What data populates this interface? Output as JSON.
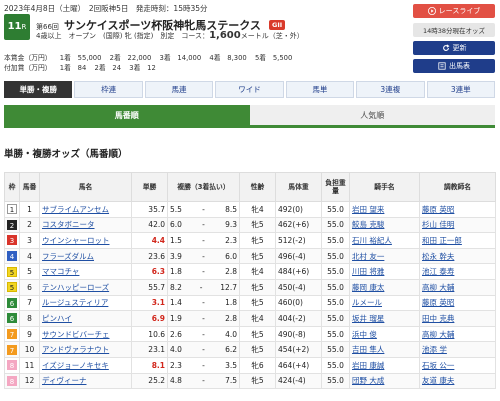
{
  "header": {
    "date_line": "2023年4月8日（土曜）　2回阪神5日　発走時刻：15時35分",
    "race_number": "11",
    "race_unit": "R",
    "race_count_label": "第66回",
    "race_name": "サンケイスポーツ杯阪神牝馬ステークス",
    "grade": "GII",
    "conditions_prefix": "4歳以上　オープン　(国際) 牝 (指定)　別定　コース：",
    "distance": "1,600",
    "conditions_suffix": "メートル（芝・外）",
    "prize_main": [
      "本賞金（万円）",
      "1着　55,000",
      "2着　22,000",
      "3着　14,000",
      "4着　8,300",
      "5着　5,500"
    ],
    "prize_extra": [
      "付加賞（万円）",
      "1着　84",
      "2着　24",
      "3着　12"
    ]
  },
  "side_buttons": {
    "live": "レースライブ",
    "time": "14時38分現在オッズ",
    "refresh": "更新",
    "entries": "出馬表"
  },
  "bet_tabs": [
    "単勝・複勝",
    "枠連",
    "馬連",
    "ワイド",
    "馬単",
    "3連複",
    "3連単"
  ],
  "view_tabs": [
    "馬番順",
    "人気順"
  ],
  "section_title": "単勝・複勝オッズ（馬番順）",
  "table": {
    "headers": {
      "waku": "枠",
      "umaban": "馬番",
      "name": "馬名",
      "win": "単勝",
      "place": "複勝（3着払い）",
      "sex_age": "性齢",
      "weight": "馬体重",
      "burden": "負担重量",
      "jockey": "騎手名",
      "trainer": "調教師名"
    },
    "rows": [
      {
        "waku": "1",
        "umaban": "1",
        "name": "サブライムアンセム",
        "win": "35.7",
        "place_min": "5.5",
        "place_dash": "-",
        "place_max": "8.5",
        "sex_age": "牝4",
        "weight": "492(0)",
        "burden": "55.0",
        "jockey": "岩田 望来",
        "trainer": "藤原 英昭",
        "hot": false
      },
      {
        "waku": "2",
        "umaban": "2",
        "name": "コスタボニータ",
        "win": "42.0",
        "place_min": "6.0",
        "place_dash": "-",
        "place_max": "9.3",
        "sex_age": "牝5",
        "weight": "462(+6)",
        "burden": "55.0",
        "jockey": "鮫島 克駿",
        "trainer": "杉山 佳明",
        "hot": false
      },
      {
        "waku": "3",
        "umaban": "3",
        "name": "ウインシャーロット",
        "win": "4.4",
        "place_min": "1.5",
        "place_dash": "-",
        "place_max": "2.3",
        "sex_age": "牝5",
        "weight": "512(-2)",
        "burden": "55.0",
        "jockey": "石川 裕紀人",
        "trainer": "和田 正一郎",
        "hot": true
      },
      {
        "waku": "4",
        "umaban": "4",
        "name": "フラーズダルム",
        "win": "23.6",
        "place_min": "3.9",
        "place_dash": "-",
        "place_max": "6.0",
        "sex_age": "牝5",
        "weight": "496(-4)",
        "burden": "55.0",
        "jockey": "北村 友一",
        "trainer": "松永 幹夫",
        "hot": false
      },
      {
        "waku": "5",
        "umaban": "5",
        "name": "ママコチャ",
        "win": "6.3",
        "place_min": "1.8",
        "place_dash": "-",
        "place_max": "2.8",
        "sex_age": "牝4",
        "weight": "484(+6)",
        "burden": "55.0",
        "jockey": "川田 将雅",
        "trainer": "池江 泰寿",
        "hot": true
      },
      {
        "waku": "5",
        "umaban": "6",
        "name": "テンハッピーローズ",
        "win": "55.7",
        "place_min": "8.2",
        "place_dash": "-",
        "place_max": "12.7",
        "sex_age": "牝5",
        "weight": "450(-4)",
        "burden": "55.0",
        "jockey": "藤岡 康太",
        "trainer": "高柳 大輔",
        "hot": false
      },
      {
        "waku": "6",
        "umaban": "7",
        "name": "ルージュスティリア",
        "win": "3.1",
        "place_min": "1.4",
        "place_dash": "-",
        "place_max": "1.8",
        "sex_age": "牝5",
        "weight": "460(0)",
        "burden": "55.0",
        "jockey": "ルメール",
        "trainer": "藤原 英昭",
        "hot": true
      },
      {
        "waku": "6",
        "umaban": "8",
        "name": "ピンハイ",
        "win": "6.9",
        "place_min": "1.9",
        "place_dash": "-",
        "place_max": "2.8",
        "sex_age": "牝4",
        "weight": "404(-2)",
        "burden": "55.0",
        "jockey": "坂井 瑠星",
        "trainer": "田中 克典",
        "hot": true
      },
      {
        "waku": "7",
        "umaban": "9",
        "name": "サウンドビバーチェ",
        "win": "10.6",
        "place_min": "2.6",
        "place_dash": "-",
        "place_max": "4.0",
        "sex_age": "牝5",
        "weight": "490(-8)",
        "burden": "55.0",
        "jockey": "浜中 俊",
        "trainer": "高柳 大輔",
        "hot": false
      },
      {
        "waku": "7",
        "umaban": "10",
        "name": "アンドヴァラナウト",
        "win": "23.1",
        "place_min": "4.0",
        "place_dash": "-",
        "place_max": "6.2",
        "sex_age": "牝5",
        "weight": "454(+2)",
        "burden": "55.0",
        "jockey": "吉田 隼人",
        "trainer": "池添 学",
        "hot": false
      },
      {
        "waku": "8",
        "umaban": "11",
        "name": "イズジョーノキセキ",
        "win": "8.1",
        "place_min": "2.3",
        "place_dash": "-",
        "place_max": "3.5",
        "sex_age": "牝6",
        "weight": "464(+4)",
        "burden": "55.0",
        "jockey": "岩田 康誠",
        "trainer": "石坂 公一",
        "hot": true
      },
      {
        "waku": "8",
        "umaban": "12",
        "name": "ディヴィーナ",
        "win": "25.2",
        "place_min": "4.8",
        "place_dash": "-",
        "place_max": "7.5",
        "sex_age": "牝5",
        "weight": "424(-4)",
        "burden": "55.0",
        "jockey": "団野 大成",
        "trainer": "友道 康夫",
        "hot": false
      }
    ]
  },
  "colors": {
    "green": "#3f8a36",
    "grade_red": "#d93a2b",
    "live_red": "#e25044",
    "navy": "#1f3d8a",
    "link_blue": "#1f4fa3",
    "hot_red": "#d1261b",
    "waku": {
      "1": {
        "bg": "#ffffff",
        "fg": "#222222",
        "border": "#999999"
      },
      "2": {
        "bg": "#222222",
        "fg": "#ffffff",
        "border": "#222222"
      },
      "3": {
        "bg": "#d9342b",
        "fg": "#ffffff",
        "border": "#d9342b"
      },
      "4": {
        "bg": "#2f5ec2",
        "fg": "#ffffff",
        "border": "#2f5ec2"
      },
      "5": {
        "bg": "#f2d623",
        "fg": "#222222",
        "border": "#d9b800"
      },
      "6": {
        "bg": "#2e8b3a",
        "fg": "#ffffff",
        "border": "#2e8b3a"
      },
      "7": {
        "bg": "#f39a1e",
        "fg": "#ffffff",
        "border": "#f39a1e"
      },
      "8": {
        "bg": "#f4a7c2",
        "fg": "#ffffff",
        "border": "#f4a7c2"
      }
    }
  },
  "icons": {
    "live": "play-icon",
    "refresh": "refresh-icon",
    "entries": "list-icon"
  }
}
